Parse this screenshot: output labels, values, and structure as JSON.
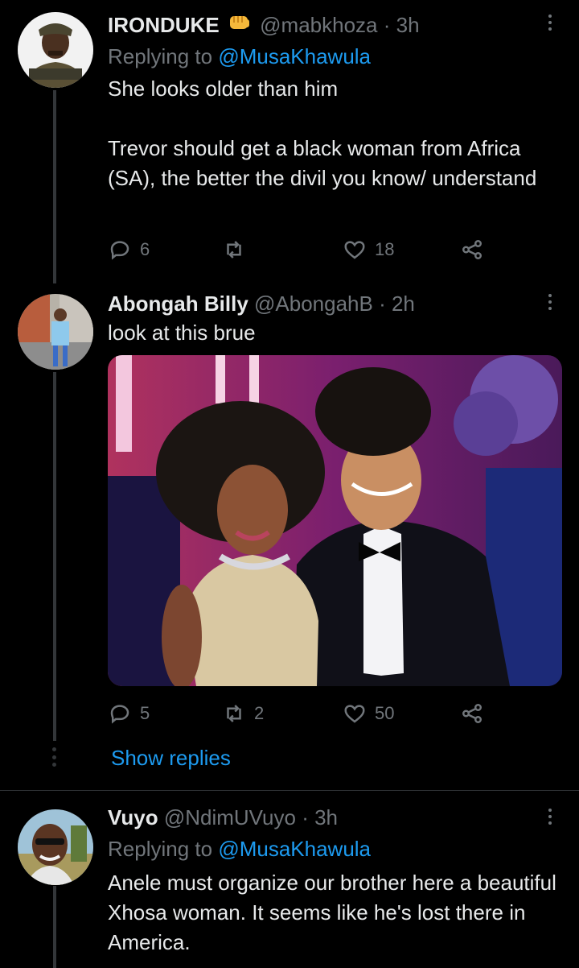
{
  "tweets": [
    {
      "name": "IRONDUKE",
      "handle": "@mabkhoza",
      "sep": " · ",
      "time": "3h",
      "replying_label": "Replying to ",
      "replying_to": "@MusaKhawula",
      "text": "She looks older than him\n\nTrevor should get a black woman from Africa (SA), the better the divil you know/ understand",
      "replies": "6",
      "retweets": "",
      "likes": "18"
    },
    {
      "name": "Abongah Billy",
      "handle": "@AbongahB",
      "sep": " · ",
      "time": "2h",
      "text": "look at this brue",
      "replies": "5",
      "retweets": "2",
      "likes": "50"
    },
    {
      "name": "Vuyo",
      "handle": "@NdimUVuyo",
      "sep": " · ",
      "time": "3h",
      "replying_label": "Replying to ",
      "replying_to": "@MusaKhawula",
      "text": "Anele must organize our brother here a beautiful Xhosa woman. It seems like he's lost there in America."
    }
  ],
  "show_replies": "Show replies",
  "icons": {
    "badge": "fist-emoji-icon",
    "reply": "reply-icon",
    "retweet": "retweet-icon",
    "like": "heart-icon",
    "share": "share-icon",
    "more": "more-icon"
  },
  "colors": {
    "background": "#000000",
    "text": "#e7e9ea",
    "muted": "#71767b",
    "link": "#1d9bf0"
  }
}
